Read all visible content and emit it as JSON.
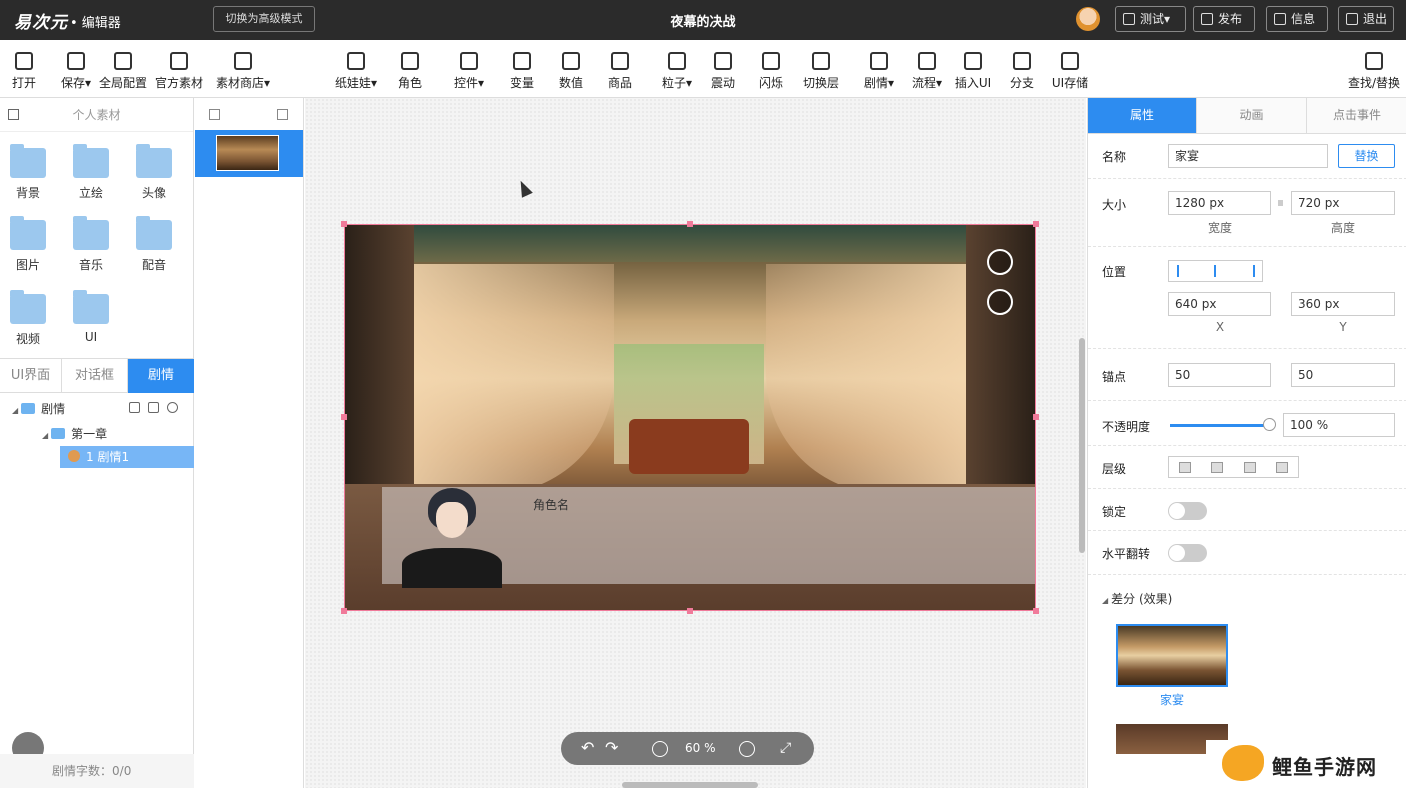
{
  "topbar": {
    "logo": "易次元",
    "app_title": "• 编辑器",
    "advanced_mode_label": "切换为高级模式",
    "document_title": "夜幕的决战",
    "buttons": [
      {
        "label": "测试▾",
        "icon": "play-icon"
      },
      {
        "label": "发布",
        "icon": "publish-icon"
      },
      {
        "label": "信息",
        "icon": "info-icon"
      },
      {
        "label": "退出",
        "icon": "exit-icon"
      }
    ]
  },
  "toolbar": {
    "left": [
      {
        "label": "打开",
        "icon": "add-file-icon"
      },
      {
        "label": "保存▾",
        "icon": "save-icon"
      },
      {
        "label": "全局配置",
        "icon": "list-icon"
      },
      {
        "label": "官方素材",
        "icon": "folder-icon"
      },
      {
        "label": "素材商店▾",
        "icon": "store-icon"
      }
    ],
    "center": [
      {
        "label": "纸娃娃▾",
        "icon": "paper-doll-icon"
      },
      {
        "label": "角色",
        "icon": "character-icon"
      },
      {
        "label": "控件▾",
        "icon": "widget-icon"
      },
      {
        "label": "变量",
        "icon": "variable-icon"
      },
      {
        "label": "数值",
        "icon": "value-icon"
      },
      {
        "label": "商品",
        "icon": "goods-icon"
      },
      {
        "label": "粒子▾",
        "icon": "particle-icon"
      },
      {
        "label": "震动",
        "icon": "shake-icon"
      },
      {
        "label": "闪烁",
        "icon": "flash-icon"
      },
      {
        "label": "切换层",
        "icon": "switch-layer-icon"
      },
      {
        "label": "剧情▾",
        "icon": "story-icon"
      },
      {
        "label": "流程▾",
        "icon": "flow-icon"
      },
      {
        "label": "插入UI",
        "icon": "insert-ui-icon"
      },
      {
        "label": "分支",
        "icon": "branch-icon"
      },
      {
        "label": "UI存储",
        "icon": "ui-storage-icon"
      }
    ],
    "right": {
      "label": "查找/替换",
      "icon": "find-replace-icon"
    }
  },
  "left_panel": {
    "header": "个人素材",
    "folders": [
      "背景",
      "立绘",
      "头像",
      "图片",
      "音乐",
      "配音",
      "视频",
      "UI"
    ],
    "tabs": [
      "UI界面",
      "对话框",
      "剧情"
    ],
    "active_tab": "剧情",
    "tree": {
      "root": "剧情",
      "chapter": "第一章",
      "item": "1  剧情1"
    },
    "word_count_label": "剧情字数：",
    "word_count_value": "0/0"
  },
  "stage": {
    "character_name": "角色名"
  },
  "zoom": {
    "value": "60 %"
  },
  "right_panel": {
    "tabs": [
      "属性",
      "动画",
      "点击事件"
    ],
    "active_tab": "属性",
    "name_label": "名称",
    "name_value": "家宴",
    "replace_button": "替换",
    "size_label": "大小",
    "width_value": "1280 px",
    "width_caption": "宽度",
    "height_value": "720 px",
    "height_caption": "高度",
    "position_label": "位置",
    "x_value": "640 px",
    "x_caption": "X",
    "y_value": "360 px",
    "y_caption": "Y",
    "anchor_label": "锚点",
    "anchor_x": "50",
    "anchor_y": "50",
    "opacity_label": "不透明度",
    "opacity_value": "100 %",
    "opacity_level": 1.0,
    "layer_label": "层级",
    "lock_label": "锁定",
    "lock_on": false,
    "flip_label": "水平翻转",
    "flip_on": false,
    "diff_header": "差分 (效果)",
    "diff_item_label": "家宴"
  },
  "watermark": {
    "text": "鲤鱼手游网"
  },
  "colors": {
    "accent": "#2d8cf0",
    "topbar": "#2b2b2b",
    "selection_handle": "#f07a9a"
  }
}
